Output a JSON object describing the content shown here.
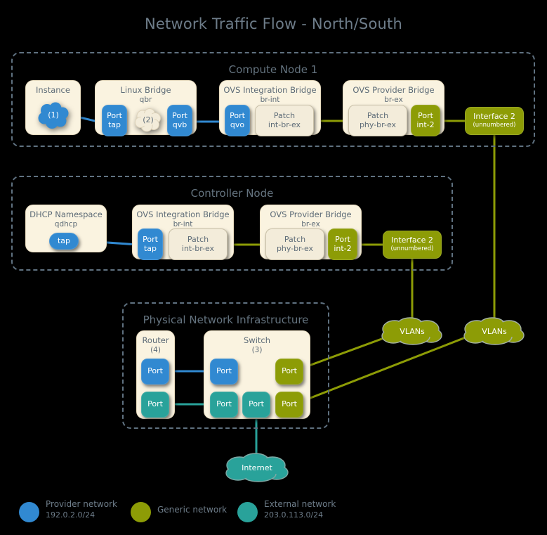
{
  "title": "Network Traffic Flow - North/South",
  "colors": {
    "provider_blue": "#3189d1",
    "generic_olive": "#8d9c06",
    "external_teal": "#29a29a",
    "card_cream": "#faf3e0",
    "dashed_border": "#5f7180",
    "title_text": "#6e7d8a",
    "background": "#000000"
  },
  "compute_node": {
    "label": "Compute Node 1",
    "instance": {
      "title": "Instance",
      "cloud_label": "(1)"
    },
    "linux_bridge": {
      "title": "Linux Bridge",
      "subtitle": "qbr",
      "port_tap": {
        "line1": "Port",
        "line2": "tap"
      },
      "cloud_label": "(2)",
      "port_qvb": {
        "line1": "Port",
        "line2": "qvb"
      }
    },
    "ovs_integration_bridge": {
      "title": "OVS Integration Bridge",
      "subtitle": "br-int",
      "port_qvo": {
        "line1": "Port",
        "line2": "qvo"
      },
      "patch": {
        "line1": "Patch",
        "line2": "int-br-ex"
      }
    },
    "ovs_provider_bridge": {
      "title": "OVS Provider Bridge",
      "subtitle": "br-ex",
      "patch": {
        "line1": "Patch",
        "line2": "phy-br-ex"
      },
      "port_int2": {
        "line1": "Port",
        "line2": "int-2"
      }
    },
    "interface2": {
      "line1": "Interface 2",
      "line2": "(unnumbered)"
    }
  },
  "controller_node": {
    "label": "Controller Node",
    "dhcp_namespace": {
      "title": "DHCP Namespace",
      "subtitle": "qdhcp",
      "tap_label": "tap"
    },
    "ovs_integration_bridge": {
      "title": "OVS Integration Bridge",
      "subtitle": "br-int",
      "port_tap": {
        "line1": "Port",
        "line2": "tap"
      },
      "patch": {
        "line1": "Patch",
        "line2": "int-br-ex"
      }
    },
    "ovs_provider_bridge": {
      "title": "OVS Provider Bridge",
      "subtitle": "br-ex",
      "patch": {
        "line1": "Patch",
        "line2": "phy-br-ex"
      },
      "port_int2": {
        "line1": "Port",
        "line2": "int-2"
      }
    },
    "interface2": {
      "line1": "Interface 2",
      "line2": "(unnumbered)"
    }
  },
  "physical_network": {
    "label": "Physical Network Infrastructure",
    "router": {
      "title": "Router",
      "subtitle": "(4)",
      "port_blue": "Port",
      "port_teal": "Port"
    },
    "switch": {
      "title": "Switch",
      "subtitle": "(3)",
      "port_blue": "Port",
      "port_teal_left": "Port",
      "port_teal_mid": "Port",
      "port_olive_top": "Port",
      "port_olive_bottom": "Port"
    }
  },
  "clouds": {
    "vlans_left": "VLANs",
    "vlans_right": "VLANs",
    "internet": "Internet"
  },
  "legend": [
    {
      "name": "Provider network",
      "cidr": "192.0.2.0/24",
      "color": "#3189d1"
    },
    {
      "name": "Generic network",
      "cidr": "",
      "color": "#8d9c06"
    },
    {
      "name": "External network",
      "cidr": "203.0.113.0/24",
      "color": "#29a29a"
    }
  ]
}
